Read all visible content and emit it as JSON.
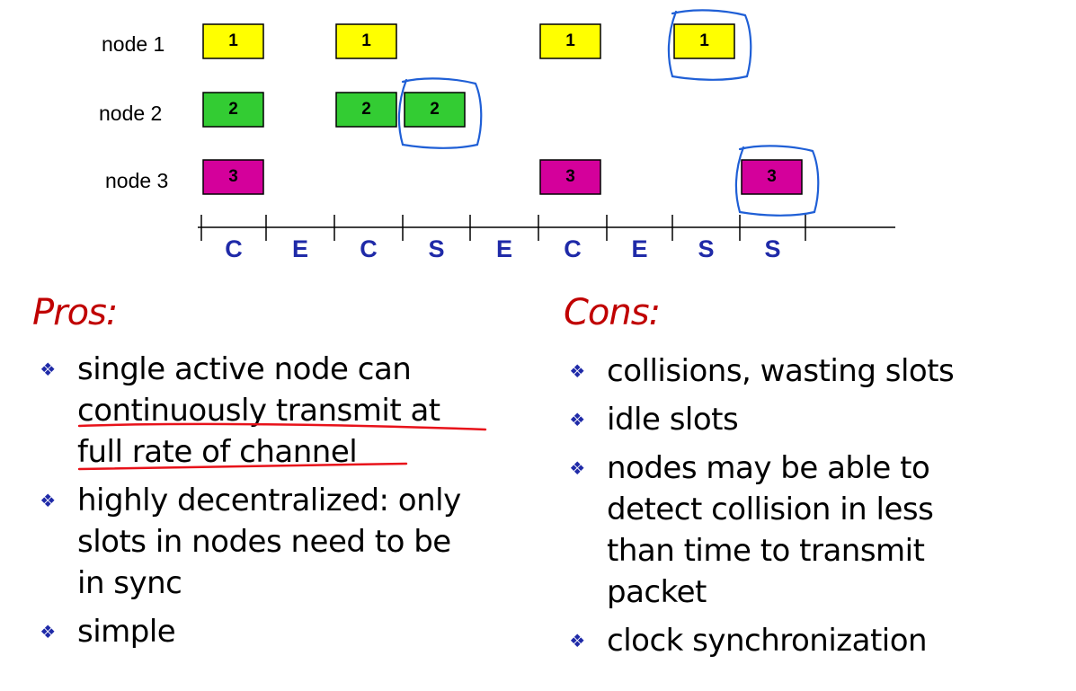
{
  "diagram": {
    "node_labels": [
      "node 1",
      "node 2",
      "node 3"
    ],
    "slot_labels": [
      "C",
      "E",
      "C",
      "S",
      "E",
      "C",
      "E",
      "S",
      "S"
    ],
    "packets": [
      {
        "node": 1,
        "slot": 0,
        "label": "1",
        "color": "#ffff00"
      },
      {
        "node": 1,
        "slot": 2,
        "label": "1",
        "color": "#ffff00"
      },
      {
        "node": 1,
        "slot": 5,
        "label": "1",
        "color": "#ffff00"
      },
      {
        "node": 1,
        "slot": 7,
        "label": "1",
        "color": "#ffff00",
        "circled": true
      },
      {
        "node": 2,
        "slot": 0,
        "label": "2",
        "color": "#33cc33"
      },
      {
        "node": 2,
        "slot": 2,
        "label": "2",
        "color": "#33cc33"
      },
      {
        "node": 2,
        "slot": 3,
        "label": "2",
        "color": "#33cc33",
        "circled": true
      },
      {
        "node": 3,
        "slot": 0,
        "label": "3",
        "color": "#d4009b"
      },
      {
        "node": 3,
        "slot": 5,
        "label": "3",
        "color": "#d4009b"
      },
      {
        "node": 3,
        "slot": 8,
        "label": "3",
        "color": "#d4009b",
        "circled": true
      }
    ],
    "annotation_color": "#1f5fd6"
  },
  "pros": {
    "heading": "Pros:",
    "items": [
      {
        "lines": [
          "single active node can",
          "continuously transmit at",
          "full rate of channel"
        ]
      },
      {
        "lines": [
          "highly decentralized: only",
          "slots in nodes need to be",
          "in sync"
        ]
      },
      {
        "lines": [
          "simple"
        ]
      }
    ]
  },
  "cons": {
    "heading": "Cons:",
    "items": [
      {
        "lines": [
          "collisions, wasting slots"
        ]
      },
      {
        "lines": [
          "idle slots"
        ]
      },
      {
        "lines": [
          "nodes may be able to",
          "detect collision in less",
          "than time to transmit",
          "packet"
        ]
      },
      {
        "lines": [
          "clock synchronization"
        ]
      }
    ]
  },
  "bullet_glyph": "❖",
  "highlight_color": "#e8121a"
}
